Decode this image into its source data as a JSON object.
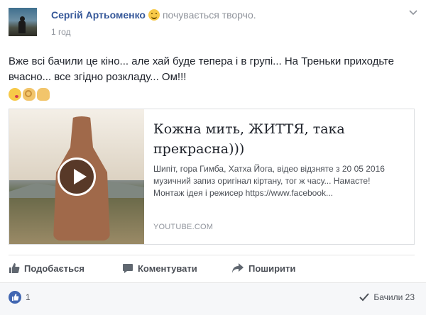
{
  "post": {
    "author": "Сергій Артьоменко",
    "feeling": "почувається творчо.",
    "time": "1 год",
    "text": "Вже всі бачили це кіно... але хай буде тепера і в групі... На Треньки приходьте вчасно... все згідно розкладу... Ом!!!",
    "emojis": [
      "kissing-face",
      "ok-hand",
      "raised-hand"
    ]
  },
  "preview": {
    "title": "Кожна мить, ЖИТТЯ, така прекрасна)))",
    "description": "Шипіт, гора Гимба, Хатха Йога, відео відзняте з 20 05 2016 музичний запиз оригінал кіртану, тог ж часу... Намасте! Монтаж ідея і режисер https://www.facebook...",
    "domain": "YOUTUBE.COM"
  },
  "actions": {
    "like": "Подобається",
    "comment": "Коментувати",
    "share": "Поширити"
  },
  "footer": {
    "like_count": "1",
    "seen": "Бачили 23"
  },
  "colors": {
    "link": "#365899",
    "like_blue": "#4267b2",
    "muted": "#90949c"
  }
}
